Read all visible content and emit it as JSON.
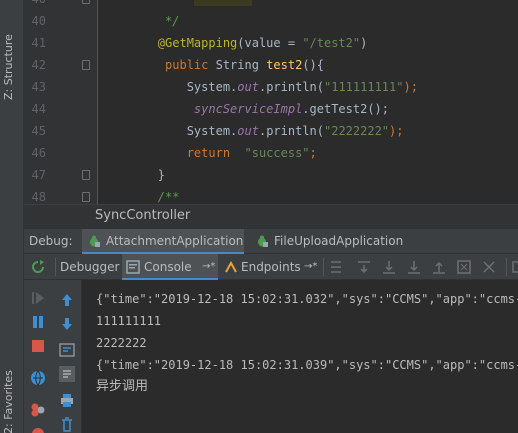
{
  "sidebar": {
    "structure_tab": "Z: Structure",
    "favorites_tab": "2: Favorites"
  },
  "editor": {
    "lines": [
      {
        "num": "40",
        "fold": true,
        "parts": [
          {
            "t": "             ",
            "c": "plain"
          },
          {
            "t": "        ",
            "c": "hl"
          }
        ]
      },
      {
        "num": "40",
        "fold": false,
        "parts": [
          {
            "t": "         ",
            "c": "plain"
          },
          {
            "t": "*/",
            "c": "cmt"
          }
        ]
      },
      {
        "num": "41",
        "fold": false,
        "parts": [
          {
            "t": "        ",
            "c": "plain"
          },
          {
            "t": "@GetMapping",
            "c": "ann"
          },
          {
            "t": "(value = ",
            "c": "plain"
          },
          {
            "t": "\"/test2\"",
            "c": "str"
          },
          {
            "t": ")",
            "c": "plain"
          }
        ]
      },
      {
        "num": "42",
        "fold": true,
        "parts": [
          {
            "t": "         ",
            "c": "plain"
          },
          {
            "t": "public ",
            "c": "kw"
          },
          {
            "t": "String ",
            "c": "plain"
          },
          {
            "t": "test2",
            "c": "fn"
          },
          {
            "t": "(){",
            "c": "plain"
          }
        ]
      },
      {
        "num": "43",
        "fold": false,
        "parts": [
          {
            "t": "            System.",
            "c": "plain"
          },
          {
            "t": "out",
            "c": "fld"
          },
          {
            "t": ".println(",
            "c": "plain"
          },
          {
            "t": "\"111111111\"",
            "c": "str"
          },
          {
            "t": ");",
            "c": "kw"
          }
        ]
      },
      {
        "num": "44",
        "fold": false,
        "parts": [
          {
            "t": "             ",
            "c": "plain"
          },
          {
            "t": "syncServiceImpl",
            "c": "fld"
          },
          {
            "t": ".getTest2();",
            "c": "plain"
          }
        ]
      },
      {
        "num": "45",
        "fold": false,
        "parts": [
          {
            "t": "            System.",
            "c": "plain"
          },
          {
            "t": "out",
            "c": "fld"
          },
          {
            "t": ".println(",
            "c": "plain"
          },
          {
            "t": "\"2222222\"",
            "c": "str"
          },
          {
            "t": ");",
            "c": "kw"
          }
        ]
      },
      {
        "num": "46",
        "fold": false,
        "parts": [
          {
            "t": "            ",
            "c": "plain"
          },
          {
            "t": "return  ",
            "c": "kw"
          },
          {
            "t": "\"success\"",
            "c": "str"
          },
          {
            "t": ";",
            "c": "kw"
          }
        ]
      },
      {
        "num": "47",
        "fold": true,
        "parts": [
          {
            "t": "        }",
            "c": "plain"
          }
        ]
      },
      {
        "num": "48",
        "fold": true,
        "parts": [
          {
            "t": "        ",
            "c": "plain"
          },
          {
            "t": "/**",
            "c": "cmt"
          }
        ]
      }
    ]
  },
  "breadcrumb": {
    "label": "SyncController"
  },
  "debug": {
    "label": "Debug:",
    "tabs": [
      {
        "label": "AttachmentApplication"
      },
      {
        "label": "FileUploadApplication"
      }
    ]
  },
  "subtabs": {
    "debugger": "Debugger",
    "console": "Console",
    "console_suffix": "→*",
    "endpoints": "Endpoints",
    "endpoints_suffix": "→*"
  },
  "console": {
    "lines": [
      "{\"time\":\"2019-12-18 15:02:31.032\",\"sys\":\"CCMS\",\"app\":\"ccms-a",
      "111111111",
      "2222222",
      "{\"time\":\"2019-12-18 15:02:31.039\",\"sys\":\"CCMS\",\"app\":\"ccms-a",
      "异步调用"
    ]
  },
  "colors": {
    "accent": "#4a88c7",
    "keyword": "#cc7832",
    "string": "#6a8759",
    "annotation": "#bbb529"
  }
}
